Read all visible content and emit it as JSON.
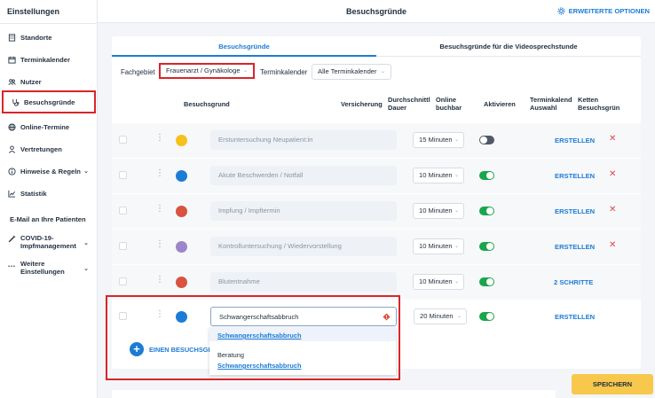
{
  "sidebar": {
    "title": "Einstellungen",
    "items": [
      {
        "label": "Standorte",
        "icon": "building-icon"
      },
      {
        "label": "Terminkalender",
        "icon": "calendar-icon"
      },
      {
        "label": "Nutzer",
        "icon": "users-icon"
      },
      {
        "label": "Besuchsgründe",
        "icon": "stethoscope-icon",
        "active": true
      },
      {
        "label": "Online-Termine",
        "icon": "globe-icon"
      },
      {
        "label": "Vertretungen",
        "icon": "person-icon"
      },
      {
        "label": "Hinweise & Regeln",
        "icon": "info-icon"
      },
      {
        "label": "Statistik",
        "icon": "chart-icon"
      },
      {
        "label": "E-Mail an Ihre Patienten"
      },
      {
        "label_line1": "COVID-19-",
        "label_line2": "Impfmanagement",
        "icon": "syringe-icon"
      },
      {
        "label_line1": "Weitere",
        "label_line2": "Einstellungen",
        "icon": "dots-icon"
      }
    ]
  },
  "header": {
    "title": "Besuchsgründe",
    "advanced": "ERWEITERTE OPTIONEN"
  },
  "tabs": [
    "Besuchsgründe",
    "Besuchsgründe für die Videosprechstunde"
  ],
  "filters": {
    "fachgebiet_label": "Fachgebiet",
    "fachgebiet_value": "Frauenarzt / Gynäkologe",
    "kalender_label": "Terminkalender",
    "kalender_value": "Alle Terminkalender"
  },
  "columns": {
    "reason": "Besuchsgrund",
    "insurance": "Versicherung",
    "duration_1": "Durchschnittl",
    "duration_2": "Dauer",
    "online_1": "Online",
    "online_2": "buchbar",
    "activate": "Aktivieren",
    "calendar_1": "Terminkalend",
    "calendar_2": "Auswahl",
    "chain_1": "Ketten",
    "chain_2": "Besuchsgrün"
  },
  "rows": [
    {
      "name": "Erstuntersuchung Neupatient:in",
      "color": "#f5c21b",
      "duration": "15 Minuten",
      "active": false,
      "action": "ERSTELLEN",
      "delete": true
    },
    {
      "name": "Akute Beschwerden / Notfall",
      "color": "#1c7cd5",
      "duration": "10 Minuten",
      "active": true,
      "action": "ERSTELLEN",
      "delete": true
    },
    {
      "name": "Impfung / Impftermin",
      "color": "#d9533f",
      "duration": "10 Minuten",
      "active": true,
      "action": "ERSTELLEN",
      "delete": true
    },
    {
      "name": "Kontrolluntersuchung / Wiedervorstellung",
      "color": "#9b86c9",
      "duration": "10 Minuten",
      "active": true,
      "action": "ERSTELLEN",
      "delete": true
    },
    {
      "name": "Blutentnahme",
      "color": "#d9533f",
      "duration": "10 Minuten",
      "active": true,
      "action": "2 SCHRITTE",
      "delete": false
    },
    {
      "name": "Schwangerschaftsabbruch",
      "color": "#1c7cd5",
      "duration": "20 Minuten",
      "active": true,
      "action": "ERSTELLEN",
      "delete": false
    }
  ],
  "dropdown": {
    "suggestion_1": "Schwangerschaftsabbruch",
    "plain": "Beratung",
    "suggestion_2": "Schwangerschaftsabbruch"
  },
  "add_label": "EINEN BESUCHSGRU",
  "save_label": "SPEICHERN",
  "colors": {
    "accent": "#1c7cd5",
    "highlight": "#d9252a",
    "save": "#f7c84b",
    "toggle_on": "#1aa64a"
  }
}
